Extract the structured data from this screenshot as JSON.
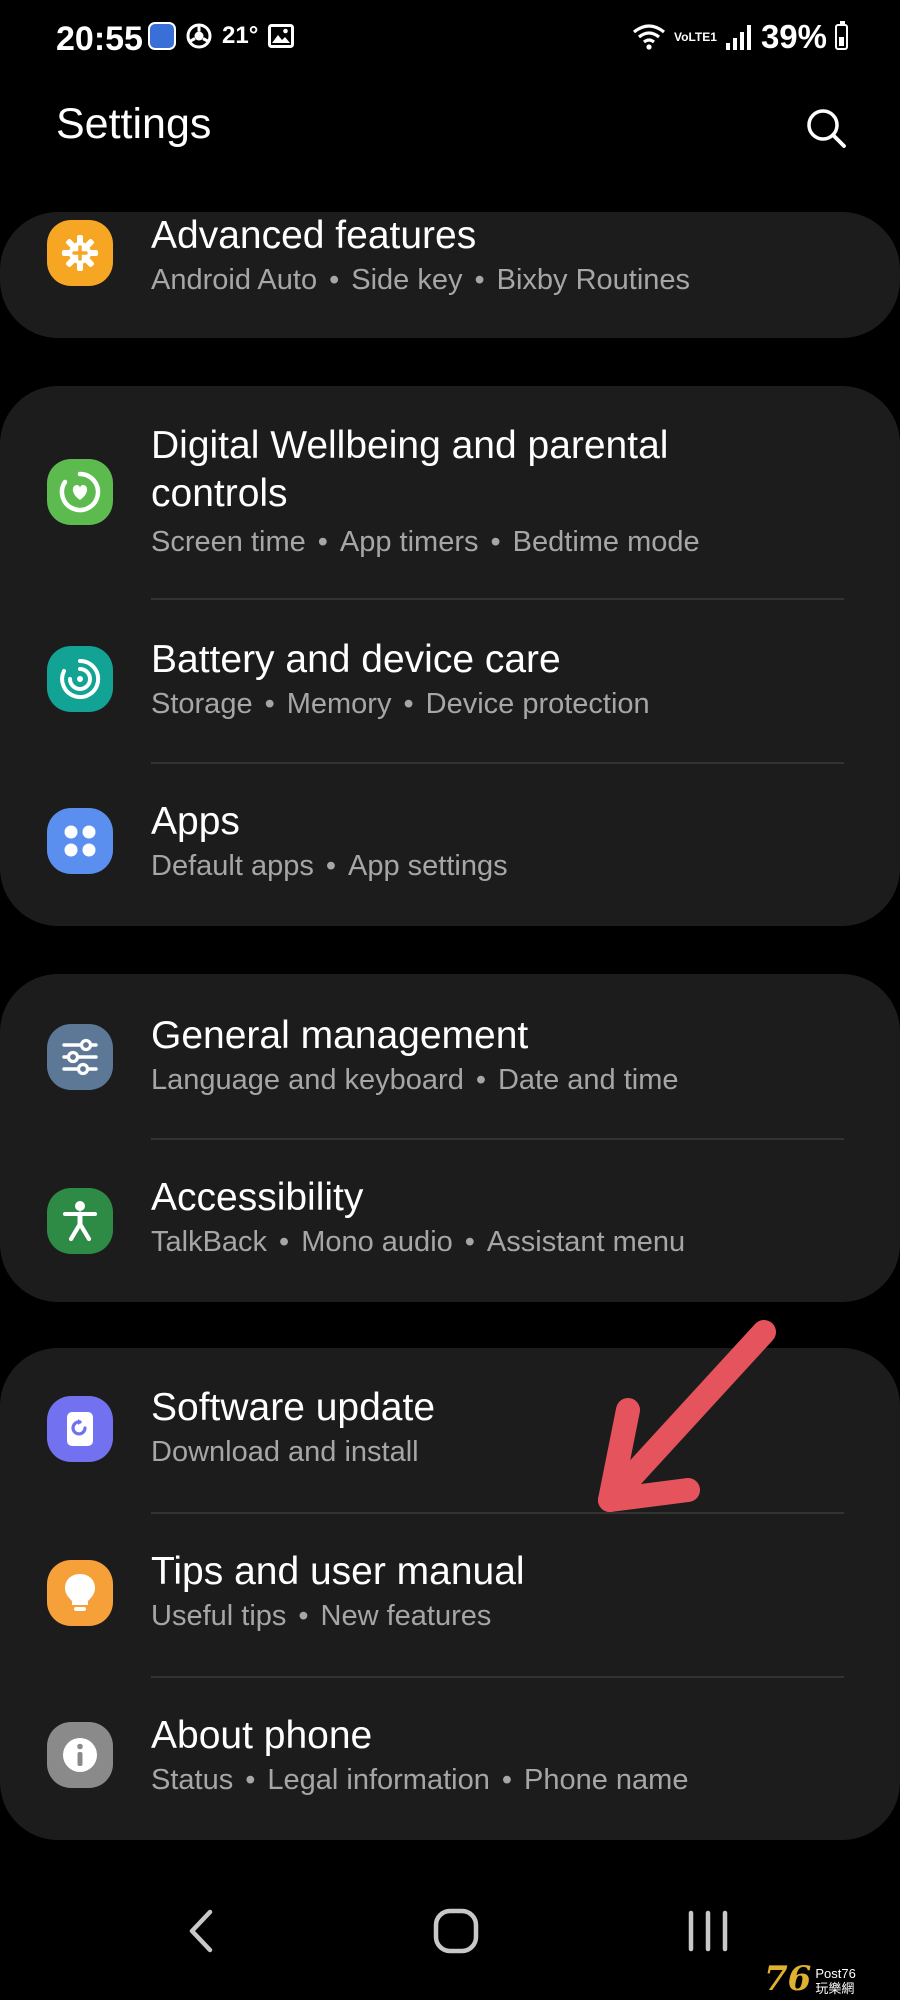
{
  "status_bar": {
    "time": "20:55",
    "temperature": "21°",
    "network_label": "VoLTE1",
    "battery": "39%"
  },
  "header": {
    "title": "Settings",
    "search_icon": "search-icon"
  },
  "groups": [
    {
      "items": [
        {
          "title": "Advanced features",
          "subtitle": [
            "Android Auto",
            "Side key",
            "Bixby Routines"
          ],
          "icon": "gear-plus-icon",
          "color": "#f6a623"
        }
      ]
    },
    {
      "items": [
        {
          "title": "Digital Wellbeing and parental controls",
          "subtitle": [
            "Screen time",
            "App timers",
            "Bedtime mode"
          ],
          "icon": "heart-ring-icon",
          "color": "#5cba4f"
        },
        {
          "title": "Battery and device care",
          "subtitle": [
            "Storage",
            "Memory",
            "Device protection"
          ],
          "icon": "device-care-icon",
          "color": "#12a394"
        },
        {
          "title": "Apps",
          "subtitle": [
            "Default apps",
            "App settings"
          ],
          "icon": "apps-grid-icon",
          "color": "#5a8ff0"
        }
      ]
    },
    {
      "items": [
        {
          "title": "General management",
          "subtitle": [
            "Language and keyboard",
            "Date and time"
          ],
          "icon": "sliders-icon",
          "color": "#5c7896"
        },
        {
          "title": "Accessibility",
          "subtitle": [
            "TalkBack",
            "Mono audio",
            "Assistant menu"
          ],
          "icon": "accessibility-person-icon",
          "color": "#2e8b45"
        }
      ]
    },
    {
      "items": [
        {
          "title": "Software update",
          "subtitle": [
            "Download and install"
          ],
          "icon": "update-icon",
          "color": "#7272f0"
        },
        {
          "title": "Tips and user manual",
          "subtitle": [
            "Useful tips",
            "New features"
          ],
          "icon": "lightbulb-icon",
          "color": "#f6a03a"
        },
        {
          "title": "About phone",
          "subtitle": [
            "Status",
            "Legal information",
            "Phone name"
          ],
          "icon": "info-icon",
          "color": "#8a8a8a"
        }
      ]
    }
  ],
  "annotation": {
    "arrow_color": "#e5545c"
  },
  "nav_bar": {
    "back": "back-icon",
    "home": "home-icon",
    "recents": "recents-icon"
  },
  "watermark": {
    "number": "76",
    "text": "Post76",
    "subtext": "玩樂網"
  }
}
